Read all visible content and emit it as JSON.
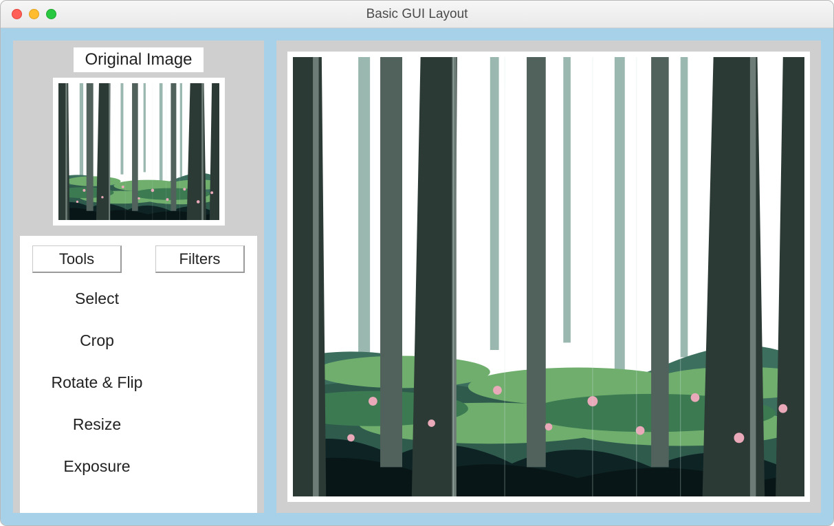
{
  "window": {
    "title": "Basic GUI Layout"
  },
  "sidebar": {
    "original_label": "Original Image",
    "tabs": {
      "tools": "Tools",
      "filters": "Filters"
    },
    "tool_items": [
      "Select",
      "Crop",
      "Rotate & Flip",
      "Resize",
      "Exposure"
    ]
  },
  "image": {
    "description": "forest-scene"
  }
}
